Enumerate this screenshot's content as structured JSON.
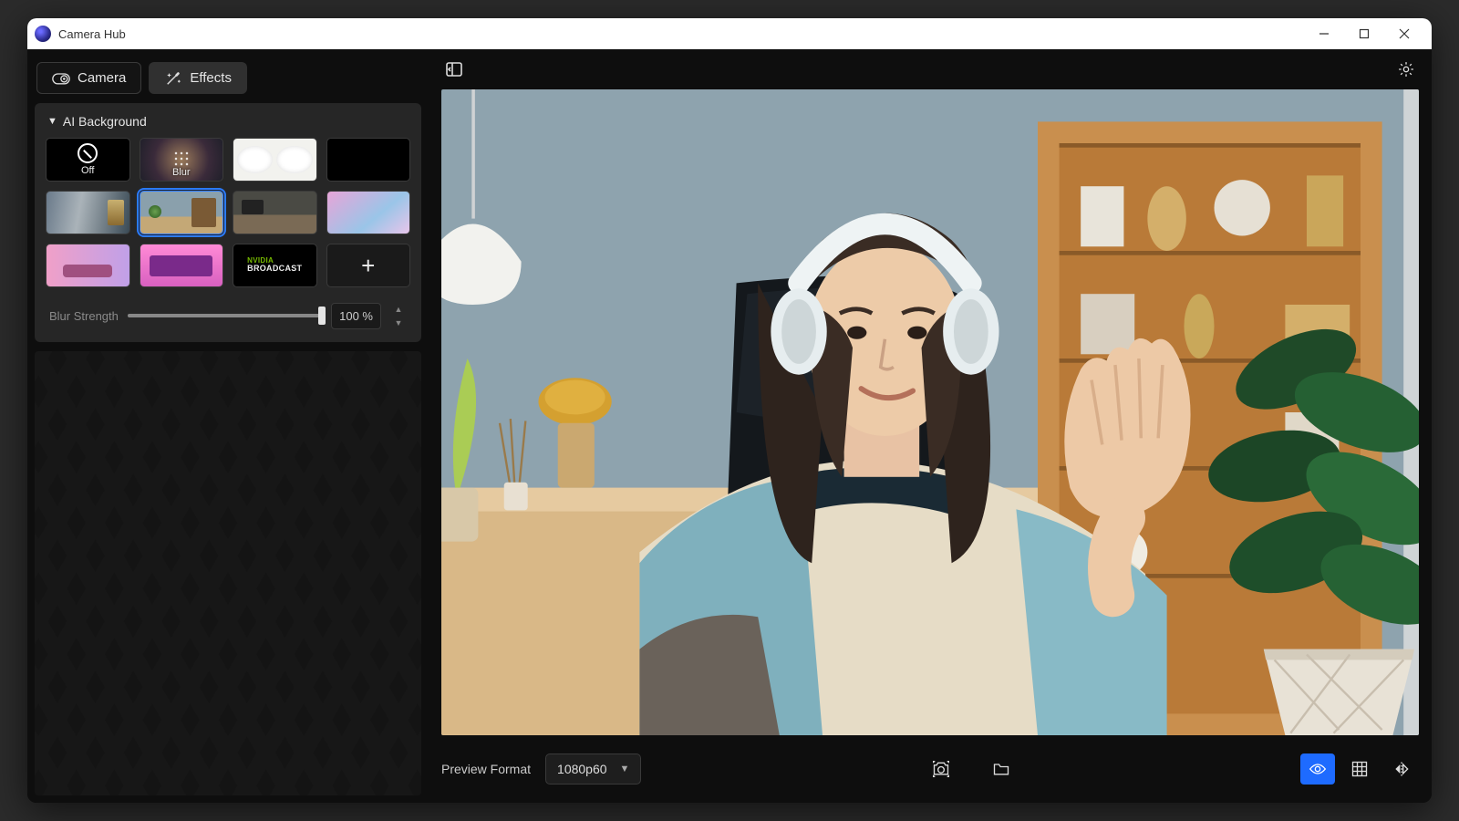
{
  "app": {
    "title": "Camera Hub"
  },
  "tabs": {
    "camera": "Camera",
    "effects": "Effects",
    "active": "effects"
  },
  "section": {
    "title": "AI Background"
  },
  "tiles": {
    "off": "Off",
    "blur": "Blur",
    "broadcast_top": "NVIDIA",
    "broadcast": "BROADCAST",
    "add": "+"
  },
  "blur": {
    "label": "Blur Strength",
    "value_text": "100 %",
    "value_pct": 100
  },
  "preview_format": {
    "label": "Preview Format",
    "value": "1080p60"
  }
}
